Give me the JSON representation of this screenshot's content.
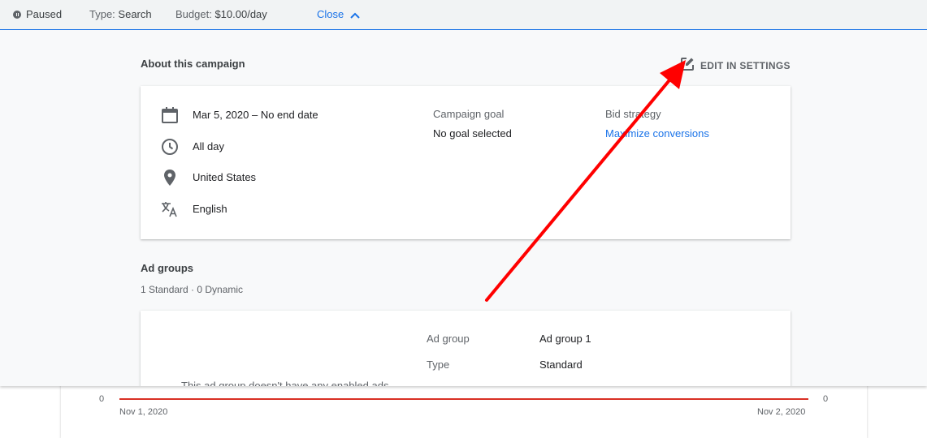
{
  "topbar": {
    "status": "Paused",
    "type_label": "Type:",
    "type_value": "Search",
    "budget_label": "Budget:",
    "budget_value": "$10.00/day",
    "close_label": "Close"
  },
  "about": {
    "title": "About this campaign",
    "edit_label": "EDIT IN SETTINGS",
    "details": {
      "dates": "Mar 5, 2020 – No end date",
      "schedule": "All day",
      "location": "United States",
      "language": "English"
    },
    "campaign_goal_label": "Campaign goal",
    "campaign_goal_value": "No goal selected",
    "bid_strategy_label": "Bid strategy",
    "bid_strategy_value": "Maximize conversions"
  },
  "ad_groups": {
    "title": "Ad groups",
    "summary": "1 Standard · 0 Dynamic",
    "empty_message": "This ad group doesn't have any enabled ads",
    "fields": [
      {
        "label": "Ad group",
        "value": "Ad group 1"
      },
      {
        "label": "Type",
        "value": "Standard"
      }
    ]
  },
  "chart": {
    "y_left": "0",
    "y_right": "0",
    "x_start": "Nov 1, 2020",
    "x_end": "Nov 2, 2020",
    "line_color": "#d93025"
  },
  "colors": {
    "accent": "#1a73e8",
    "annotation_arrow": "#ff0000"
  },
  "icons": [
    "pause-icon",
    "chevron-up-icon",
    "edit-icon",
    "calendar-icon",
    "clock-icon",
    "location-pin-icon",
    "translate-icon"
  ]
}
